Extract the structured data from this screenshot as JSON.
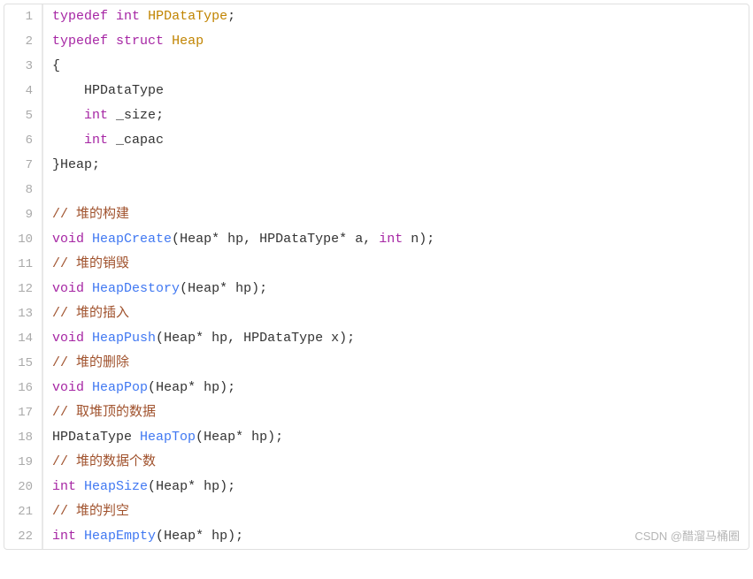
{
  "watermark": "CSDN @醋溜马桶圈",
  "lines": [
    {
      "num": "1",
      "tokens": [
        {
          "cls": "kw-typedef",
          "t": "typedef"
        },
        {
          "cls": "",
          "t": " "
        },
        {
          "cls": "kw-type",
          "t": "int"
        },
        {
          "cls": "",
          "t": " "
        },
        {
          "cls": "type-name",
          "t": "HPDataType"
        },
        {
          "cls": "punct",
          "t": ";"
        }
      ]
    },
    {
      "num": "2",
      "tokens": [
        {
          "cls": "kw-typedef",
          "t": "typedef"
        },
        {
          "cls": "",
          "t": " "
        },
        {
          "cls": "kw-struct",
          "t": "struct"
        },
        {
          "cls": "",
          "t": " "
        },
        {
          "cls": "type-name",
          "t": "Heap"
        }
      ]
    },
    {
      "num": "3",
      "tokens": [
        {
          "cls": "brace",
          "t": "{"
        }
      ]
    },
    {
      "num": "4",
      "tokens": [
        {
          "cls": "",
          "t": "    "
        },
        {
          "cls": "ident",
          "t": "HPDataType"
        }
      ]
    },
    {
      "num": "5",
      "tokens": [
        {
          "cls": "",
          "t": "    "
        },
        {
          "cls": "kw-type",
          "t": "int"
        },
        {
          "cls": "",
          "t": " "
        },
        {
          "cls": "ident",
          "t": "_size"
        },
        {
          "cls": "punct",
          "t": ";"
        }
      ]
    },
    {
      "num": "6",
      "tokens": [
        {
          "cls": "",
          "t": "    "
        },
        {
          "cls": "kw-type",
          "t": "int"
        },
        {
          "cls": "",
          "t": " "
        },
        {
          "cls": "ident",
          "t": "_capac"
        }
      ]
    },
    {
      "num": "7",
      "tokens": [
        {
          "cls": "brace",
          "t": "}"
        },
        {
          "cls": "ident",
          "t": "Heap"
        },
        {
          "cls": "punct",
          "t": ";"
        }
      ]
    },
    {
      "num": "8",
      "tokens": []
    },
    {
      "num": "9",
      "tokens": [
        {
          "cls": "comment",
          "t": "// 堆的构建"
        }
      ]
    },
    {
      "num": "10",
      "tokens": [
        {
          "cls": "kw-type",
          "t": "void"
        },
        {
          "cls": "",
          "t": " "
        },
        {
          "cls": "func-name",
          "t": "HeapCreate"
        },
        {
          "cls": "punct",
          "t": "("
        },
        {
          "cls": "ident",
          "t": "Heap"
        },
        {
          "cls": "punct",
          "t": "*"
        },
        {
          "cls": "",
          "t": " "
        },
        {
          "cls": "ident",
          "t": "hp"
        },
        {
          "cls": "punct",
          "t": ", "
        },
        {
          "cls": "ident",
          "t": "HPDataType"
        },
        {
          "cls": "punct",
          "t": "*"
        },
        {
          "cls": "",
          "t": " "
        },
        {
          "cls": "ident",
          "t": "a"
        },
        {
          "cls": "punct",
          "t": ", "
        },
        {
          "cls": "kw-type",
          "t": "int"
        },
        {
          "cls": "",
          "t": " "
        },
        {
          "cls": "ident",
          "t": "n"
        },
        {
          "cls": "punct",
          "t": ");"
        }
      ]
    },
    {
      "num": "11",
      "tokens": [
        {
          "cls": "comment",
          "t": "// 堆的销毁"
        }
      ]
    },
    {
      "num": "12",
      "tokens": [
        {
          "cls": "kw-type",
          "t": "void"
        },
        {
          "cls": "",
          "t": " "
        },
        {
          "cls": "func-name",
          "t": "HeapDestory"
        },
        {
          "cls": "punct",
          "t": "("
        },
        {
          "cls": "ident",
          "t": "Heap"
        },
        {
          "cls": "punct",
          "t": "*"
        },
        {
          "cls": "",
          "t": " "
        },
        {
          "cls": "ident",
          "t": "hp"
        },
        {
          "cls": "punct",
          "t": ");"
        }
      ]
    },
    {
      "num": "13",
      "tokens": [
        {
          "cls": "comment",
          "t": "// 堆的插入"
        }
      ]
    },
    {
      "num": "14",
      "tokens": [
        {
          "cls": "kw-type",
          "t": "void"
        },
        {
          "cls": "",
          "t": " "
        },
        {
          "cls": "func-name",
          "t": "HeapPush"
        },
        {
          "cls": "punct",
          "t": "("
        },
        {
          "cls": "ident",
          "t": "Heap"
        },
        {
          "cls": "punct",
          "t": "*"
        },
        {
          "cls": "",
          "t": " "
        },
        {
          "cls": "ident",
          "t": "hp"
        },
        {
          "cls": "punct",
          "t": ", "
        },
        {
          "cls": "ident",
          "t": "HPDataType x"
        },
        {
          "cls": "punct",
          "t": ");"
        }
      ]
    },
    {
      "num": "15",
      "tokens": [
        {
          "cls": "comment",
          "t": "// 堆的删除"
        }
      ]
    },
    {
      "num": "16",
      "tokens": [
        {
          "cls": "kw-type",
          "t": "void"
        },
        {
          "cls": "",
          "t": " "
        },
        {
          "cls": "func-name",
          "t": "HeapPop"
        },
        {
          "cls": "punct",
          "t": "("
        },
        {
          "cls": "ident",
          "t": "Heap"
        },
        {
          "cls": "punct",
          "t": "*"
        },
        {
          "cls": "",
          "t": " "
        },
        {
          "cls": "ident",
          "t": "hp"
        },
        {
          "cls": "punct",
          "t": ");"
        }
      ]
    },
    {
      "num": "17",
      "tokens": [
        {
          "cls": "comment",
          "t": "// 取堆顶的数据"
        }
      ]
    },
    {
      "num": "18",
      "tokens": [
        {
          "cls": "ident",
          "t": "HPDataType"
        },
        {
          "cls": "",
          "t": " "
        },
        {
          "cls": "func-name",
          "t": "HeapTop"
        },
        {
          "cls": "punct",
          "t": "("
        },
        {
          "cls": "ident",
          "t": "Heap"
        },
        {
          "cls": "punct",
          "t": "*"
        },
        {
          "cls": "",
          "t": " "
        },
        {
          "cls": "ident",
          "t": "hp"
        },
        {
          "cls": "punct",
          "t": ");"
        }
      ]
    },
    {
      "num": "19",
      "tokens": [
        {
          "cls": "comment",
          "t": "// 堆的数据个数"
        }
      ]
    },
    {
      "num": "20",
      "tokens": [
        {
          "cls": "kw-type",
          "t": "int"
        },
        {
          "cls": "",
          "t": " "
        },
        {
          "cls": "func-name",
          "t": "HeapSize"
        },
        {
          "cls": "punct",
          "t": "("
        },
        {
          "cls": "ident",
          "t": "Heap"
        },
        {
          "cls": "punct",
          "t": "*"
        },
        {
          "cls": "",
          "t": " "
        },
        {
          "cls": "ident",
          "t": "hp"
        },
        {
          "cls": "punct",
          "t": ");"
        }
      ]
    },
    {
      "num": "21",
      "tokens": [
        {
          "cls": "comment",
          "t": "// 堆的判空"
        }
      ]
    },
    {
      "num": "22",
      "tokens": [
        {
          "cls": "kw-type",
          "t": "int"
        },
        {
          "cls": "",
          "t": " "
        },
        {
          "cls": "func-name",
          "t": "HeapEmpty"
        },
        {
          "cls": "punct",
          "t": "("
        },
        {
          "cls": "ident",
          "t": "Heap"
        },
        {
          "cls": "punct",
          "t": "*"
        },
        {
          "cls": "",
          "t": " "
        },
        {
          "cls": "ident",
          "t": "hp"
        },
        {
          "cls": "punct",
          "t": ");"
        }
      ]
    }
  ]
}
